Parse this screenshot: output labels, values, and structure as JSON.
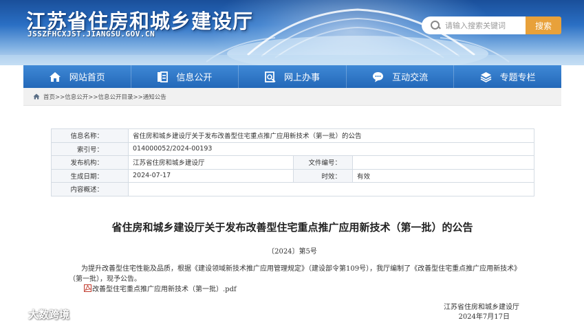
{
  "header": {
    "title": "江苏省住房和城乡建设厅",
    "domain": "JSSZFHCXJST.JIANGSU.GOV.CN",
    "search": {
      "placeholder": "请输入搜索关键词",
      "button_label": "搜索"
    }
  },
  "nav": {
    "items": [
      {
        "label": "网站首页",
        "icon": "home-icon"
      },
      {
        "label": "信息公开",
        "icon": "document-icon"
      },
      {
        "label": "网上办事",
        "icon": "form-icon"
      },
      {
        "label": "互动交流",
        "icon": "chat-icon"
      },
      {
        "label": "专题专栏",
        "icon": "layers-icon"
      }
    ]
  },
  "breadcrumb": {
    "text": "首页>>信息公开>>信息公开目录>>通知公告"
  },
  "info": {
    "name_label": "信息名称：",
    "name_value": "省住房和城乡建设厅关于发布改善型住宅重点推广应用新技术（第一批）的公告",
    "index_label": "索引号：",
    "index_value": "014000052/2024-00193",
    "org_label": "发布机构：",
    "org_value": "江苏省住房和城乡建设厅",
    "fileno_label": "文件编号：",
    "fileno_value": "",
    "date_label": "生成日期：",
    "date_value": "2024-07-17",
    "validity_label": "时效：",
    "validity_value": "有效",
    "summary_label": "内容概述：",
    "summary_value": ""
  },
  "article": {
    "title": "省住房和城乡建设厅关于发布改善型住宅重点推广应用新技术（第一批）的公告",
    "doc_number": "〔2024〕第5号",
    "body": "为提升改善型住宅性能及品质，根据《建设领域新技术推广应用管理规定》（建设部令第109号），我厅编制了《改善型住宅重点推广应用新技术》（第一批），现予公告。",
    "attachment": "改善型住宅重点推广应用新技术（第一批）.pdf",
    "signer": "江苏省住房和城乡建设厅",
    "sign_date": "2024年7月17日"
  },
  "watermark": {
    "text": "大数跨境"
  },
  "colors": {
    "nav_bg": "#2f7acb",
    "search_button": "#e8a13a",
    "table_border": "#d4dbe3",
    "label_bg": "#f4f6f9"
  }
}
